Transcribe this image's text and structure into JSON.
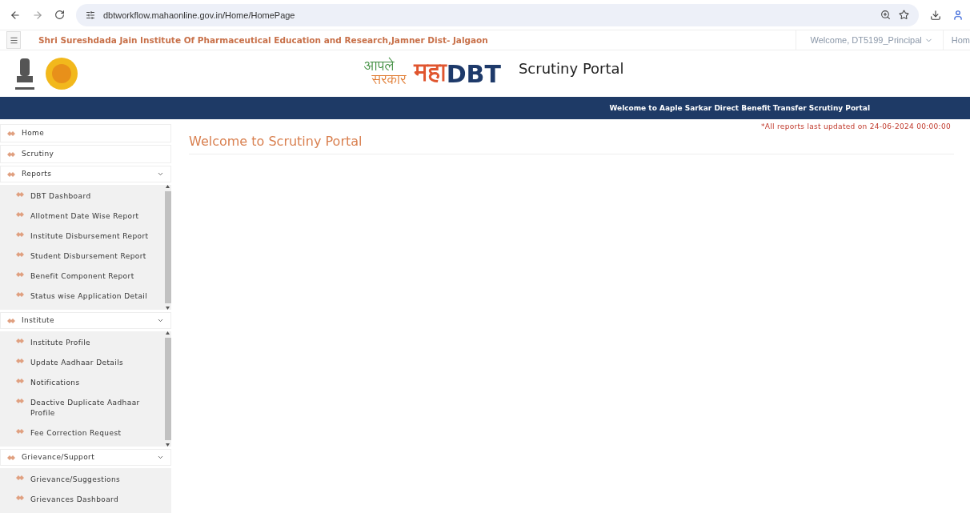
{
  "browser": {
    "url": "dbtworkflow.mahaonline.gov.in/Home/HomePage"
  },
  "topbar": {
    "institute": "Shri Sureshdada Jain Institute Of Pharmaceutical Education and Research,Jamner Dist- Jalgaon",
    "user": "Welcome, DT5199_Principal",
    "home_link": "Hom"
  },
  "header": {
    "logo_line1": "आपले",
    "logo_line2": "सरकार",
    "brand_prefix": "महा",
    "brand_suffix": "DBT",
    "portal_title": "Scrutiny Portal"
  },
  "banner": "Welcome to Aaple Sarkar Direct Benefit Transfer Scrutiny Portal",
  "notice": "*All reports last updated on 24-06-2024 00:00:00",
  "page_title": "Welcome to Scrutiny Portal",
  "sidebar": {
    "items": [
      {
        "kind": "link",
        "label": "Home"
      },
      {
        "kind": "link",
        "label": "Scrutiny"
      },
      {
        "kind": "group",
        "label": "Reports",
        "expanded": true,
        "children": [
          {
            "label": "DBT Dashboard"
          },
          {
            "label": "Allotment Date Wise Report"
          },
          {
            "label": "Institute Disbursement Report"
          },
          {
            "label": "Student Disbursement Report"
          },
          {
            "label": "Benefit Component Report"
          },
          {
            "label": "Status wise Application Detail"
          }
        ]
      },
      {
        "kind": "group",
        "label": "Institute",
        "expanded": true,
        "children": [
          {
            "label": "Institute Profile"
          },
          {
            "label": "Update Aadhaar Details"
          },
          {
            "label": "Notifications"
          },
          {
            "label": "Deactive Duplicate Aadhaar Profile"
          },
          {
            "label": "Fee Correction Request"
          }
        ]
      },
      {
        "kind": "group",
        "label": "Grievance/Support",
        "expanded": true,
        "children": [
          {
            "label": "Grievance/Suggestions"
          },
          {
            "label": "Grievances Dashboard"
          }
        ]
      }
    ]
  }
}
